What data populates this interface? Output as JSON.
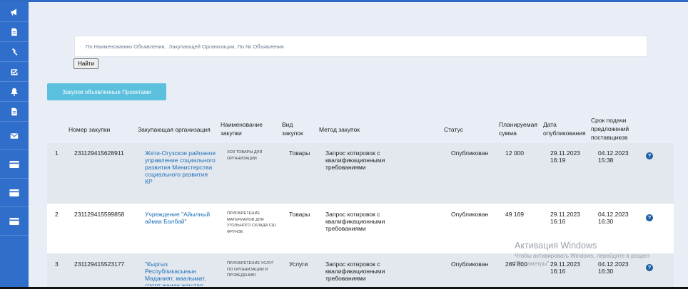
{
  "search": {
    "placeholder": "По Наименованию Объявления,  Закупающей Организации, По № Объявления",
    "button_label": "Найти"
  },
  "projects_button": "Закупки объявленные Проектами",
  "table": {
    "headers": {
      "num": "Номер закупки",
      "org": "Закупающая организация",
      "name": "Наименование закупки",
      "type": "Вид закупок",
      "method": "Метод закупок",
      "status": "Статус",
      "sum": "Планируемая сумма",
      "date": "Дата опубликования",
      "deadline": "Срок подачи предложений поставщиков"
    },
    "rows": [
      {
        "idx": "1",
        "num": "231129415628911",
        "org": "Жети-Огузское районное управление социального развития Министерства социального развития КР",
        "name": "ХОЗ ТОВАРЫ ДЛЯ ОРГАНИЗАЦИИ",
        "type": "Товары",
        "method": "Запрос котировок с квалификационными требованиями",
        "status": "Опубликован",
        "sum": "12 000",
        "date": "29.11.2023 16:19",
        "deadline": "04.12.2023 15:38"
      },
      {
        "idx": "2",
        "num": "231129415599858",
        "org": "Учреждение \"Айылный аймак Балбай\"",
        "name": "ПРИОБРЕТЕНИЕ МАТЕРИАЛОВ ДЛЯ УГОЛЬНОГО СКЛАДА СШ. ФРУНЗЕ",
        "type": "Товары",
        "method": "Запрос котировок с квалификационными требованиями",
        "status": "Опубликован",
        "sum": "49 169",
        "date": "29.11.2023 16:16",
        "deadline": "04.12.2023 16:30"
      },
      {
        "idx": "3",
        "num": "231129415523177",
        "org": "\"Кыргыз Республикасынын Маданият, маалымат, спорт жанан жаштар",
        "name": "ПРИОБРЕТЕНИЕ УСЛУГ ПО ОРГАНИЗАЦИИ И ПРОВЕДЕНИЮ",
        "type": "Услуги",
        "method": "Запрос котировок с квалификационными требованиями",
        "status": "Опубликован",
        "sum": "289 800",
        "date": "29.11.2023 16:16",
        "deadline": "04.12.2023 16:30"
      }
    ]
  },
  "watermark": {
    "title": "Активация Windows",
    "subtitle": "Чтобы активировать Windows, перейдите в раздел \"Параметры\"."
  },
  "icons": [
    "megaphone-icon",
    "document-icon",
    "hammer-icon",
    "checkbox-icon",
    "bell-icon",
    "document-icon",
    "envelope-icon",
    "card-icon",
    "card-icon",
    "card-icon",
    "question-icon"
  ],
  "colors": {
    "sidebar": "#2f6ecb",
    "accent_button": "#5bc0de",
    "link": "#1f72b8",
    "help_icon": "#1b5fa6"
  }
}
